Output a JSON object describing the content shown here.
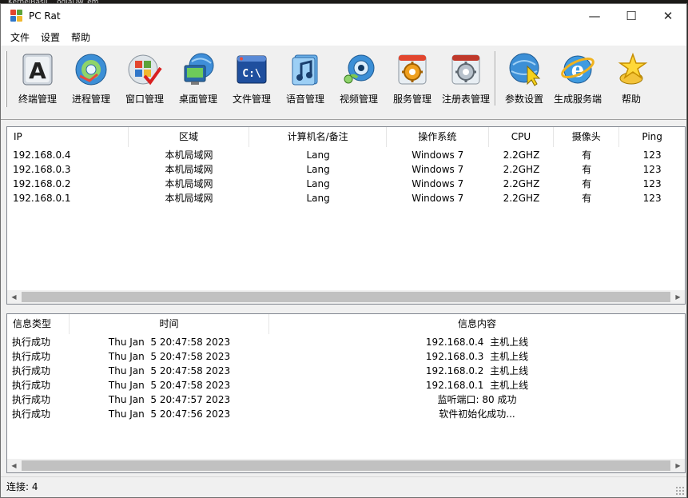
{
  "desktop_peek": "KernelBasil... ogiaDw_em",
  "window": {
    "title": "PC Rat",
    "controls": {
      "minimize": "—",
      "maximize": "☐",
      "close": "✕"
    }
  },
  "menu": [
    "文件",
    "设置",
    "帮助"
  ],
  "toolbar": [
    {
      "label": "终端管理",
      "icon": "terminal-icon"
    },
    {
      "label": "进程管理",
      "icon": "process-disc-icon"
    },
    {
      "label": "窗口管理",
      "icon": "window-check-icon"
    },
    {
      "label": "桌面管理",
      "icon": "desktop-globe-icon"
    },
    {
      "label": "文件管理",
      "icon": "command-prompt-icon"
    },
    {
      "label": "语音管理",
      "icon": "audio-note-icon"
    },
    {
      "label": "视频管理",
      "icon": "webcam-icon"
    },
    {
      "label": "服务管理",
      "icon": "service-gear-icon"
    },
    {
      "label": "注册表管理",
      "icon": "registry-gear-icon"
    },
    {
      "label": "参数设置",
      "icon": "settings-globe-cursor-icon"
    },
    {
      "label": "生成服务端",
      "icon": "build-ie-icon"
    },
    {
      "label": "帮助",
      "icon": "help-star-icon"
    }
  ],
  "clients": {
    "columns": [
      "IP",
      "区域",
      "计算机名/备注",
      "操作系统",
      "CPU",
      "摄像头",
      "Ping"
    ],
    "rows": [
      [
        "192.168.0.4",
        "本机局域网",
        "Lang",
        "Windows 7",
        "2.2GHZ",
        "有",
        "123"
      ],
      [
        "192.168.0.3",
        "本机局域网",
        "Lang",
        "Windows 7",
        "2.2GHZ",
        "有",
        "123"
      ],
      [
        "192.168.0.2",
        "本机局域网",
        "Lang",
        "Windows 7",
        "2.2GHZ",
        "有",
        "123"
      ],
      [
        "192.168.0.1",
        "本机局域网",
        "Lang",
        "Windows 7",
        "2.2GHZ",
        "有",
        "123"
      ]
    ]
  },
  "logs": {
    "columns": [
      "信息类型",
      "时间",
      "信息内容"
    ],
    "rows": [
      [
        "执行成功",
        "Thu Jan  5 20:47:58 2023",
        "192.168.0.4  主机上线"
      ],
      [
        "执行成功",
        "Thu Jan  5 20:47:58 2023",
        "192.168.0.3  主机上线"
      ],
      [
        "执行成功",
        "Thu Jan  5 20:47:58 2023",
        "192.168.0.2  主机上线"
      ],
      [
        "执行成功",
        "Thu Jan  5 20:47:58 2023",
        "192.168.0.1  主机上线"
      ],
      [
        "执行成功",
        "Thu Jan  5 20:47:57 2023",
        "监听端口: 80 成功"
      ],
      [
        "执行成功",
        "Thu Jan  5 20:47:56 2023",
        "软件初始化成功..."
      ]
    ]
  },
  "scroll_arrows": {
    "left": "◀",
    "right": "▶"
  },
  "status": "连接: 4"
}
